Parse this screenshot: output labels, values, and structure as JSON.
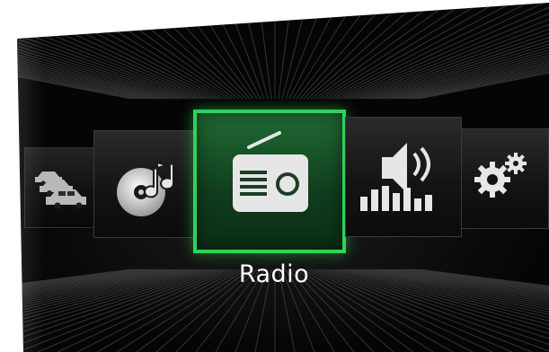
{
  "menu": {
    "selected_label": "Radio",
    "items": [
      {
        "id": "vehicle",
        "icon": "cars-icon"
      },
      {
        "id": "media",
        "icon": "cd-music-note-icon"
      },
      {
        "id": "radio",
        "icon": "radio-icon",
        "selected": true
      },
      {
        "id": "sound",
        "icon": "speaker-volume-icon"
      },
      {
        "id": "settings",
        "icon": "gears-icon"
      }
    ]
  },
  "colors": {
    "background": "#050505",
    "selected_border": "#2fd15a",
    "selected_fill": "#1f6b33",
    "icon": "#e6e6e6",
    "label": "#ffffff"
  }
}
